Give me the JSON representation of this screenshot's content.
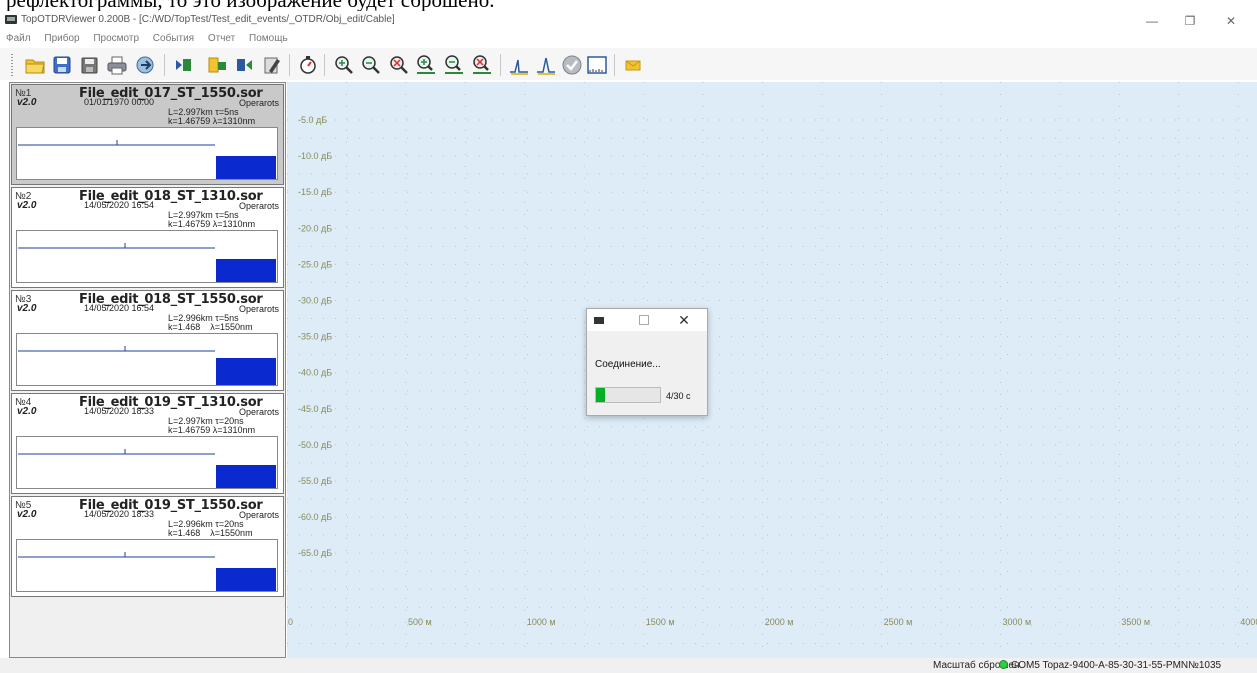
{
  "document_fragment": "рефлектограммы, то это изображение будет сброшено.",
  "window": {
    "title": "TopOTDRViewer 0.200B - [C:/WD/TopTest/Test_edit_events/_OTDR/Obj_edit/Cable]",
    "minimize": "—",
    "restore": "❐",
    "close": "✕"
  },
  "menu": [
    "Файл",
    "Прибор",
    "Просмотр",
    "События",
    "Отчет",
    "Помощь"
  ],
  "toolbar": {
    "icons": [
      "open-folder-icon",
      "save-icon",
      "save-all-icon",
      "print-icon",
      "export-icon",
      "previous-trace-icon",
      "add-trace-icon",
      "next-trace-icon",
      "edit-trace-icon",
      "measure-icon",
      "zoom-in-icon",
      "zoom-out-icon",
      "zoom-reset-icon",
      "zoom-in-horizontal-icon",
      "zoom-out-horizontal-icon",
      "zoom-reset-horizontal-icon",
      "reflective-event-icon",
      "peak-event-icon",
      "check-icon",
      "scale-icon",
      "report-icon"
    ]
  },
  "traces": [
    {
      "num": "№1",
      "version": "v2.0",
      "file": "File_edit_017_ST_1550.sor",
      "date": "01/01/1970 00:00",
      "operator": "Operarots",
      "line1": "L=2.997km τ=5ns",
      "line2": "k=1.46759 λ=1310nm"
    },
    {
      "num": "№2",
      "version": "v2.0",
      "file": "File_edit_018_ST_1310.sor",
      "date": "14/05/2020 16:54",
      "operator": "Operarots",
      "line1": "L=2.997km τ=5ns",
      "line2": "k=1.46759 λ=1310nm"
    },
    {
      "num": "№3",
      "version": "v2.0",
      "file": "File_edit_018_ST_1550.sor",
      "date": "14/05/2020 16:54",
      "operator": "Operarots",
      "line1": "L=2.996km τ=5ns",
      "line2": "k=1.468    λ=1550nm"
    },
    {
      "num": "№4",
      "version": "v2.0",
      "file": "File_edit_019_ST_1310.sor",
      "date": "14/05/2020 18:33",
      "operator": "Operarots",
      "line1": "L=2.997km τ=20ns",
      "line2": "k=1.46759 λ=1310nm"
    },
    {
      "num": "№5",
      "version": "v2.0",
      "file": "File_edit_019_ST_1550.sor",
      "date": "14/05/2020 18:33",
      "operator": "Operarots",
      "line1": "L=2.996km τ=20ns",
      "line2": "k=1.468    λ=1550nm"
    }
  ],
  "selected_trace": 0,
  "chart_data": {
    "type": "line",
    "y_ticks": [
      "-5.0 дБ",
      "-10.0 дБ",
      "-15.0 дБ",
      "-20.0 дБ",
      "-25.0 дБ",
      "-30.0 дБ",
      "-35.0 дБ",
      "-40.0 дБ",
      "-45.0 дБ",
      "-50.0 дБ",
      "-55.0 дБ",
      "-60.0 дБ",
      "-65.0 дБ"
    ],
    "x_ticks": [
      "0",
      "500 м",
      "1000 м",
      "1500 м",
      "2000 м",
      "2500 м",
      "3000 м",
      "3500 м",
      "4000"
    ],
    "series": [],
    "grid": true,
    "background": "#deecf8"
  },
  "dialog": {
    "message": "Соединение...",
    "progress": 0.133,
    "time": "4/30 с",
    "close": "✕"
  },
  "status": {
    "zoom": "Масштаб сброшен",
    "connection": "COM5 Topaz-9400-A-85-30-31-55-PMN№1035",
    "led_color": "#2ecc40"
  }
}
